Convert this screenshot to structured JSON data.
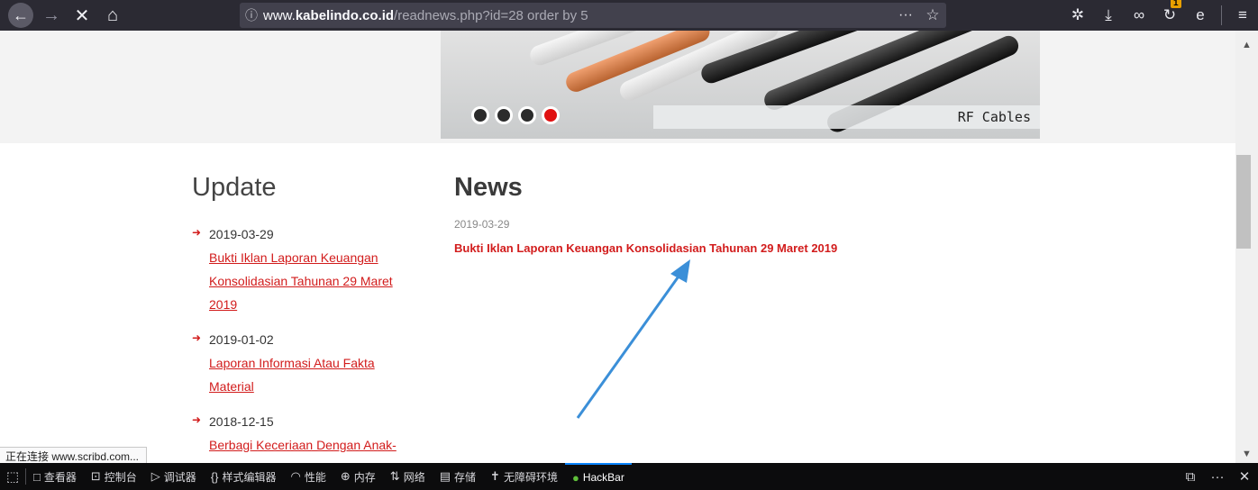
{
  "browser": {
    "url_prefix": "www.",
    "url_host": "kabelindo.co.id",
    "url_path": "/readnews.php?id=28 order by 5",
    "icons": [
      "back-icon",
      "forward-icon",
      "stop-icon",
      "home-icon",
      "info-icon",
      "more-icon",
      "bookmark-star-icon",
      "extension-icon",
      "download-icon",
      "infinity-icon",
      "sync-icon",
      "edge-icon",
      "menu-icon"
    ],
    "badge": "1"
  },
  "banner": {
    "caption": "RF Cables",
    "dots": 4,
    "active_dot": 4
  },
  "update": {
    "title": "Update",
    "items": [
      {
        "date": "2019-03-29",
        "title": "Bukti Iklan Laporan Keuangan Konsolidasian Tahunan 29 Maret 2019"
      },
      {
        "date": "2019-01-02",
        "title": "Laporan Informasi Atau Fakta Material"
      },
      {
        "date": "2018-12-15",
        "title": "Berbagi Keceriaan Dengan Anak-anak di Panti Asuhan"
      }
    ]
  },
  "news": {
    "title": "News",
    "date": "2019-03-29",
    "headline": "Bukti Iklan Laporan Keuangan Konsolidasian Tahunan 29 Maret 2019"
  },
  "status_text": "正在连接 www.scribd.com...",
  "devtools": {
    "tabs": [
      {
        "icon": "□",
        "label": "查看器"
      },
      {
        "icon": "⊡",
        "label": "控制台"
      },
      {
        "icon": "▷",
        "label": "调试器"
      },
      {
        "icon": "{}",
        "label": "样式编辑器"
      },
      {
        "icon": "◠",
        "label": "性能"
      },
      {
        "icon": "⊕",
        "label": "内存"
      },
      {
        "icon": "⇅",
        "label": "网络"
      },
      {
        "icon": "▤",
        "label": "存储"
      },
      {
        "icon": "✝",
        "label": "无障碍环境"
      },
      {
        "icon": "●",
        "label": "HackBar"
      }
    ],
    "active_tab": "HackBar"
  },
  "colors": {
    "accent": "#d21c1c",
    "toolbar": "#2b2a33",
    "devtools": "#0c0c0d",
    "annotation_arrow": "#3b8fd8"
  }
}
